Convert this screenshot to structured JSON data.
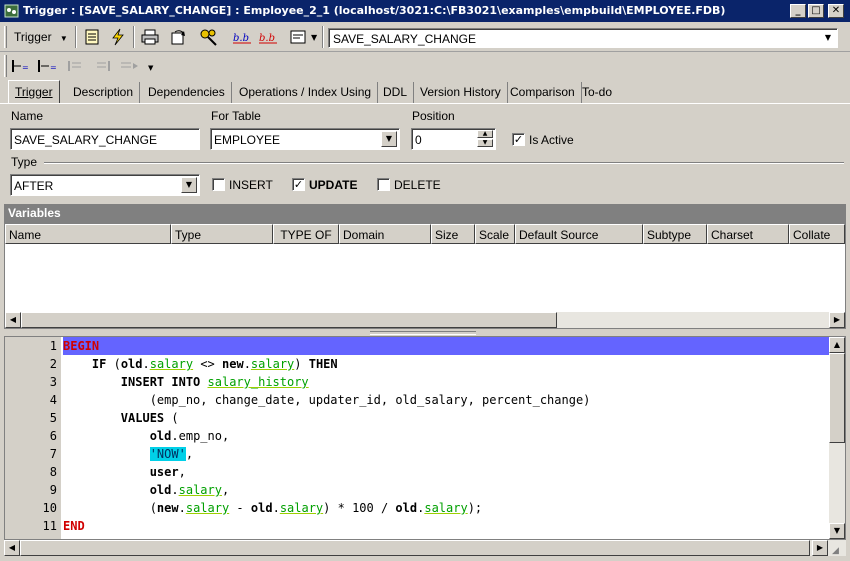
{
  "window": {
    "title": "Trigger : [SAVE_SALARY_CHANGE] : Employee_2_1 (localhost/3021:C:\\FB3021\\examples\\empbuild\\EMPLOYEE.FDB)",
    "minimize": "_",
    "restore": "□",
    "close": "✕"
  },
  "toolbar": {
    "object_type": "Trigger",
    "object_selector": "SAVE_SALARY_CHANGE",
    "icons": [
      "table-icon",
      "lightning-icon",
      "print-icon",
      "rotate-icon",
      "keys-icon",
      "format-icon-1",
      "format-icon-2",
      "sql-icon"
    ],
    "icons2": [
      "indent-left-icon",
      "indent-right-icon",
      "align-left-icon",
      "align-right-icon",
      "more-icon"
    ]
  },
  "tabs": [
    "Trigger",
    "Description",
    "Dependencies",
    "Operations / Index Using",
    "DDL",
    "Version History",
    "Comparison",
    "To-do"
  ],
  "form": {
    "name_label": "Name",
    "name_value": "SAVE_SALARY_CHANGE",
    "table_label": "For Table",
    "table_value": "EMPLOYEE",
    "position_label": "Position",
    "position_value": "0",
    "is_active_label": "Is Active",
    "is_active": true,
    "type_label": "Type",
    "type_value": "AFTER",
    "insert_label": "INSERT",
    "insert": false,
    "update_label": "UPDATE",
    "update": true,
    "delete_label": "DELETE",
    "delete": false
  },
  "variables": {
    "title": "Variables",
    "columns": [
      "Name",
      "Type",
      "TYPE OF",
      "Domain",
      "Size",
      "Scale",
      "Default Source",
      "Subtype",
      "Charset",
      "Collate"
    ]
  },
  "editor": {
    "line_numbers": [
      "1",
      "2",
      "3",
      "4",
      "5",
      "6",
      "7",
      "8",
      "9",
      "10",
      "11"
    ],
    "colors": {
      "current_line": "#6464ff",
      "keyword_red": "#d00000",
      "field_green": "#00a000",
      "string_bg": "#00d0e8"
    }
  }
}
